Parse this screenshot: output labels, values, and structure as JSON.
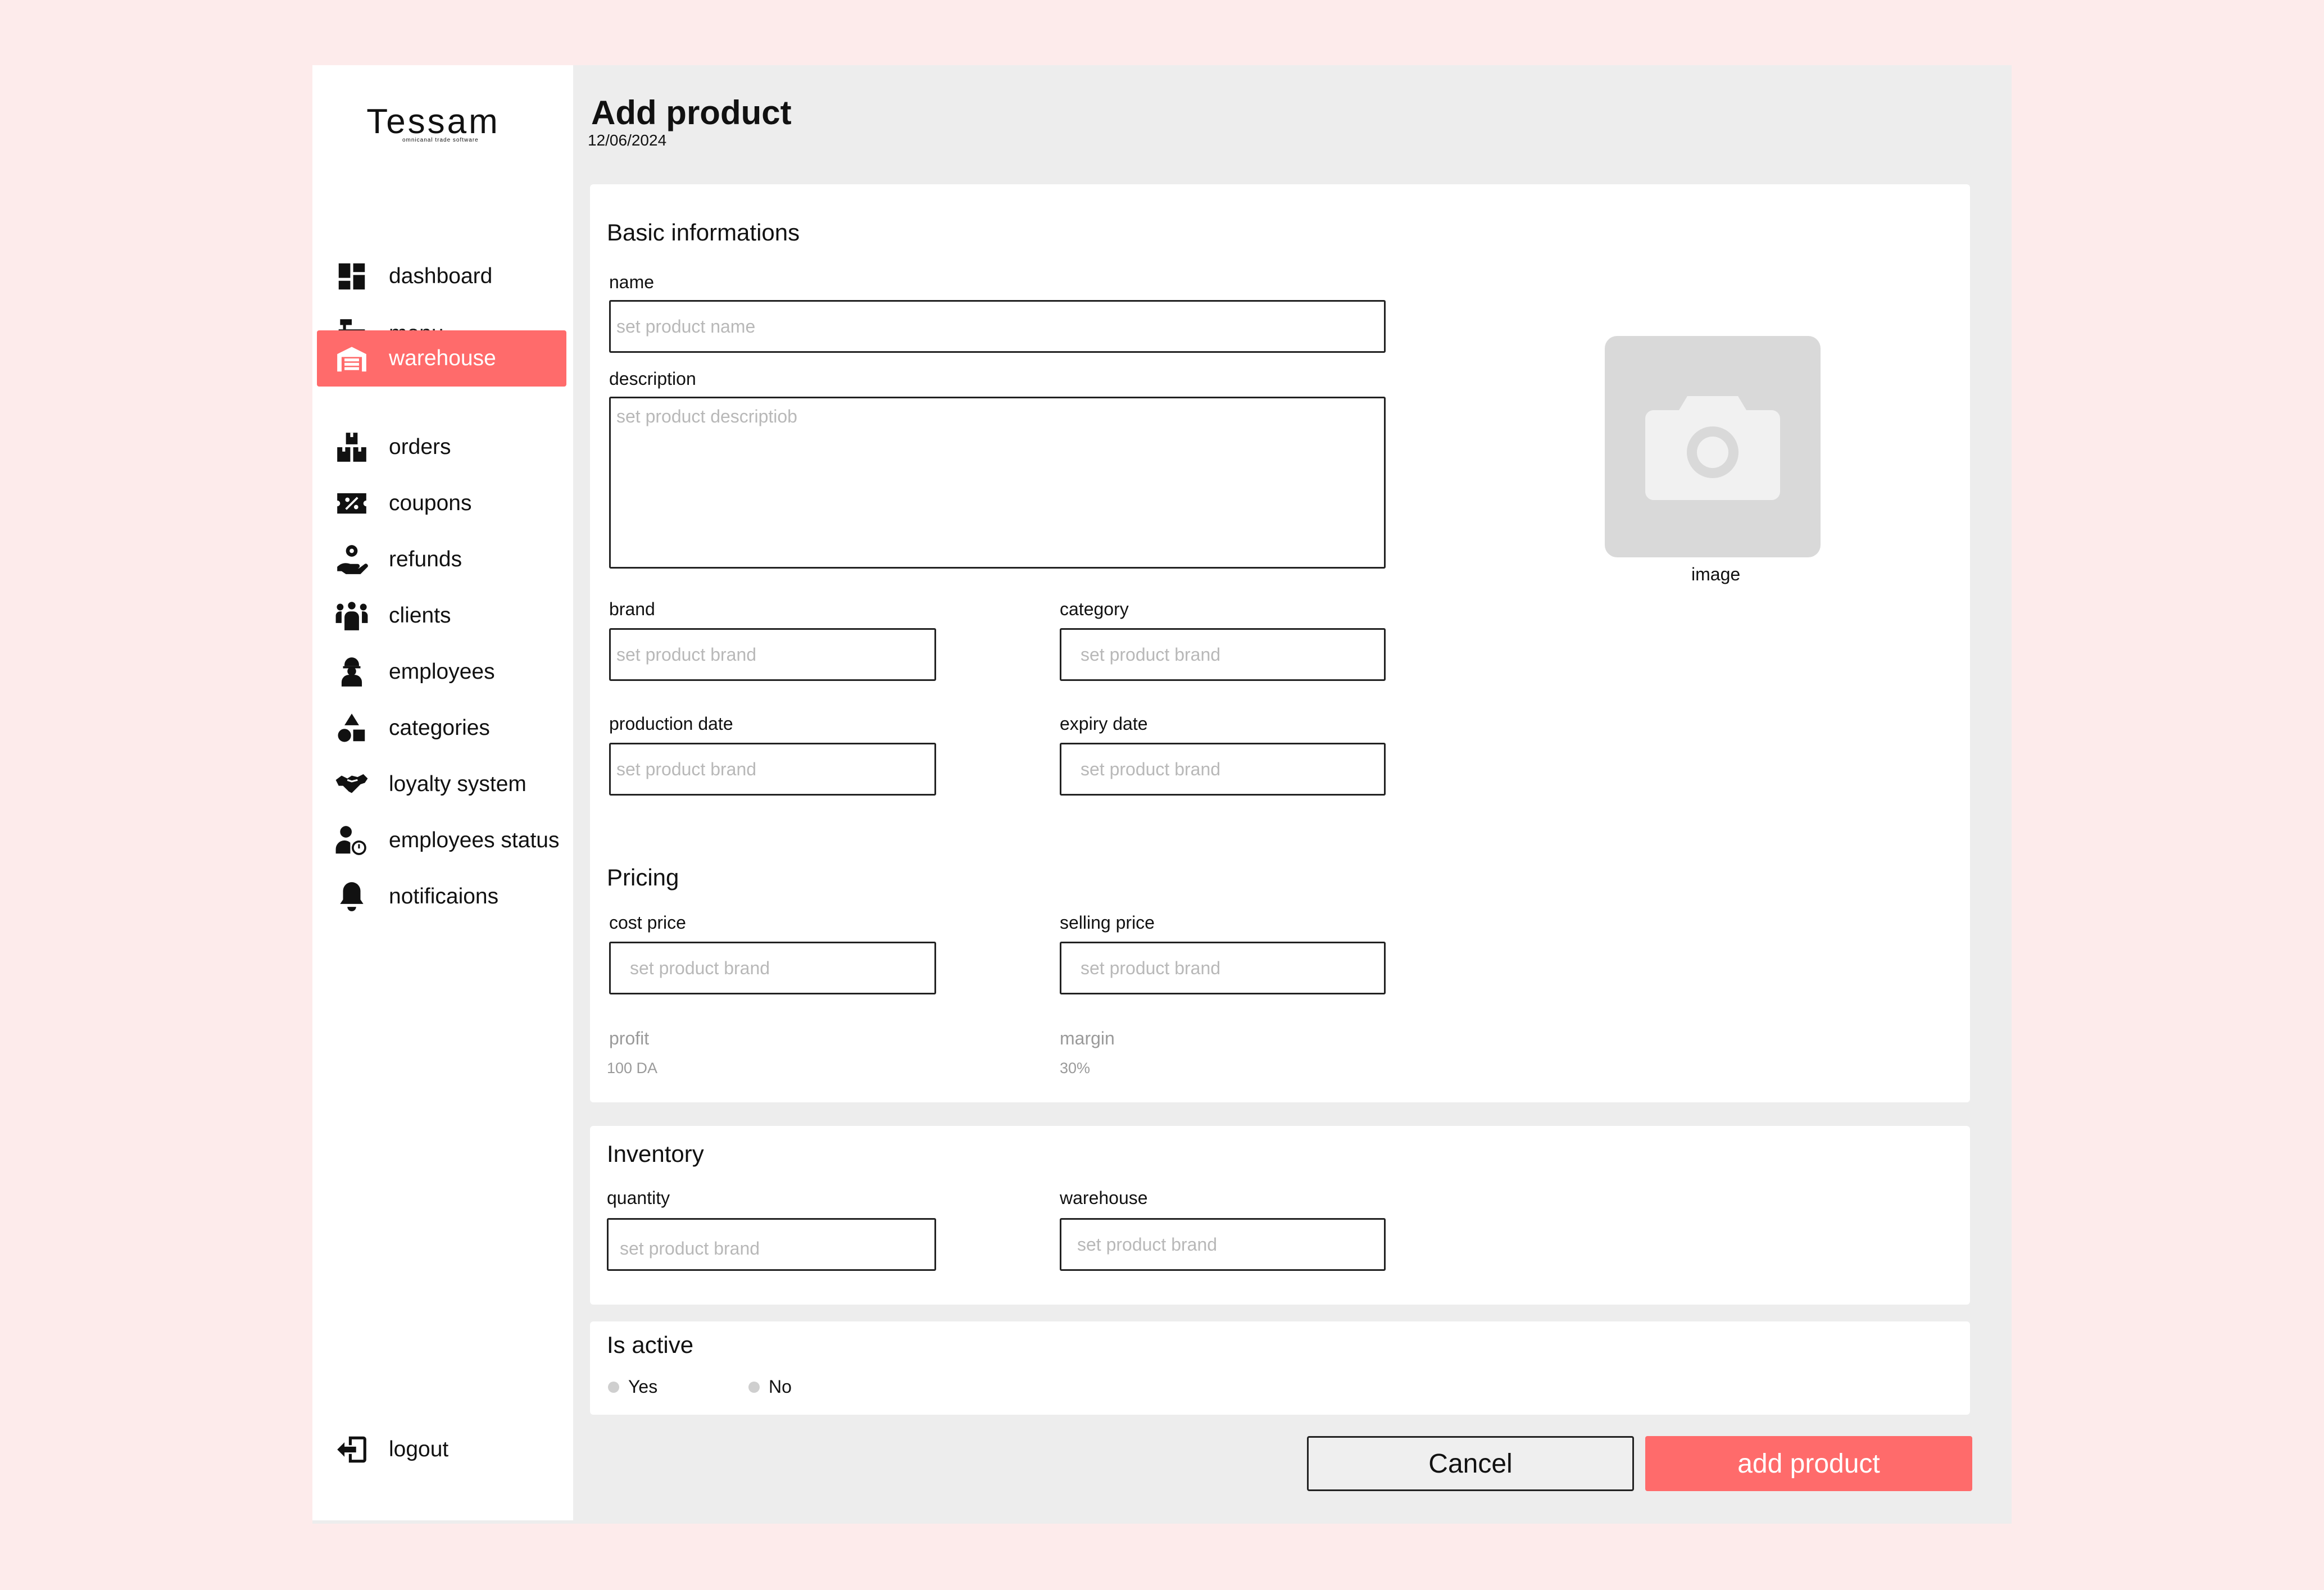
{
  "brand": {
    "name": "Tessam",
    "tagline": "omnicanal trade software"
  },
  "colors": {
    "accent": "#ff6b6b",
    "page_bg": "#fdebeb",
    "panel_bg": "#ededed",
    "placeholder": "#b8b8b8"
  },
  "sidebar": {
    "items": [
      {
        "label": "dashboard",
        "icon": "dashboard-icon"
      },
      {
        "label": "menu",
        "icon": "cash-register-icon"
      },
      {
        "label": "warehouse",
        "icon": "warehouse-icon",
        "active": true
      },
      {
        "label": "orders",
        "icon": "boxes-icon"
      },
      {
        "label": "coupons",
        "icon": "coupon-icon"
      },
      {
        "label": "refunds",
        "icon": "refund-hand-icon"
      },
      {
        "label": "clients",
        "icon": "people-group-icon"
      },
      {
        "label": "employees",
        "icon": "worker-icon"
      },
      {
        "label": "categories",
        "icon": "shapes-icon"
      },
      {
        "label": "loyalty system",
        "icon": "handshake-icon"
      },
      {
        "label": "employees status",
        "icon": "user-clock-icon"
      },
      {
        "label": "notificaions",
        "icon": "bell-icon"
      }
    ],
    "logout": {
      "label": "logout",
      "icon": "logout-icon"
    }
  },
  "header": {
    "title": "Add product",
    "date": "12/06/2024"
  },
  "basic": {
    "title": "Basic informations",
    "name": {
      "label": "name",
      "placeholder": "set product name"
    },
    "description": {
      "label": "description",
      "placeholder": "set product descriptiob"
    },
    "brand": {
      "label": "brand",
      "placeholder": "set product brand"
    },
    "category": {
      "label": "category",
      "placeholder": "set product brand"
    },
    "production_date": {
      "label": "production date",
      "placeholder": "set product brand"
    },
    "expiry_date": {
      "label": "expiry date",
      "placeholder": "set product brand"
    },
    "image_label": "image"
  },
  "pricing": {
    "title": "Pricing",
    "cost_price": {
      "label": "cost price",
      "placeholder": "set product brand"
    },
    "selling_price": {
      "label": "selling price",
      "placeholder": "set product brand"
    },
    "profit": {
      "label": "profit",
      "value": "100 DA"
    },
    "margin": {
      "label": "margin",
      "value": "30%"
    }
  },
  "inventory": {
    "title": "Inventory",
    "quantity": {
      "label": "quantity",
      "placeholder": "set product brand"
    },
    "warehouse": {
      "label": "warehouse",
      "placeholder": "set product brand"
    }
  },
  "active": {
    "title": "Is active",
    "yes": "Yes",
    "no": "No"
  },
  "actions": {
    "cancel": "Cancel",
    "add": "add product"
  }
}
